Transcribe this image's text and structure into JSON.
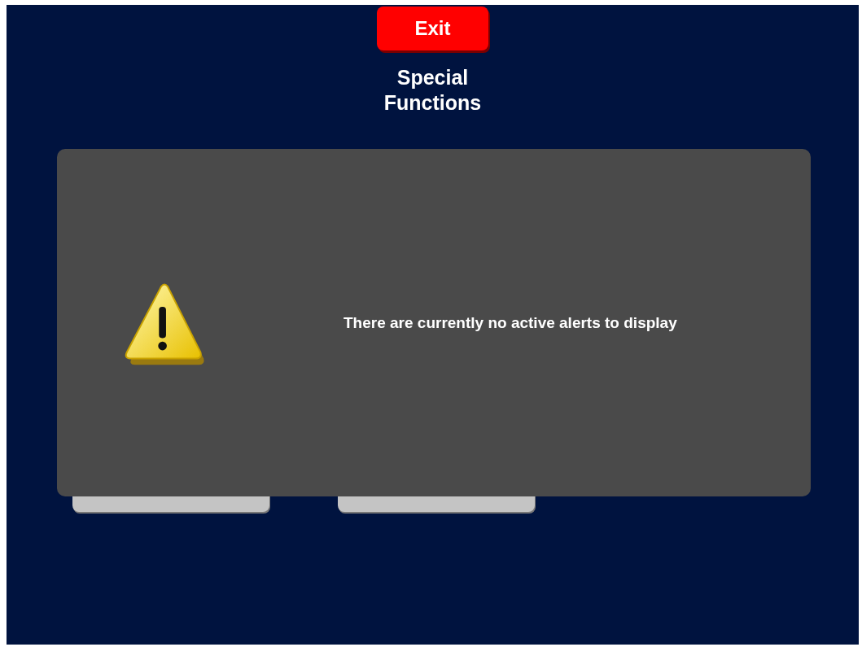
{
  "exit_button": {
    "label": "Exit"
  },
  "title": [
    "Special",
    "Functions"
  ],
  "alert_dialog": {
    "message": "There are currently no active alerts to display"
  }
}
